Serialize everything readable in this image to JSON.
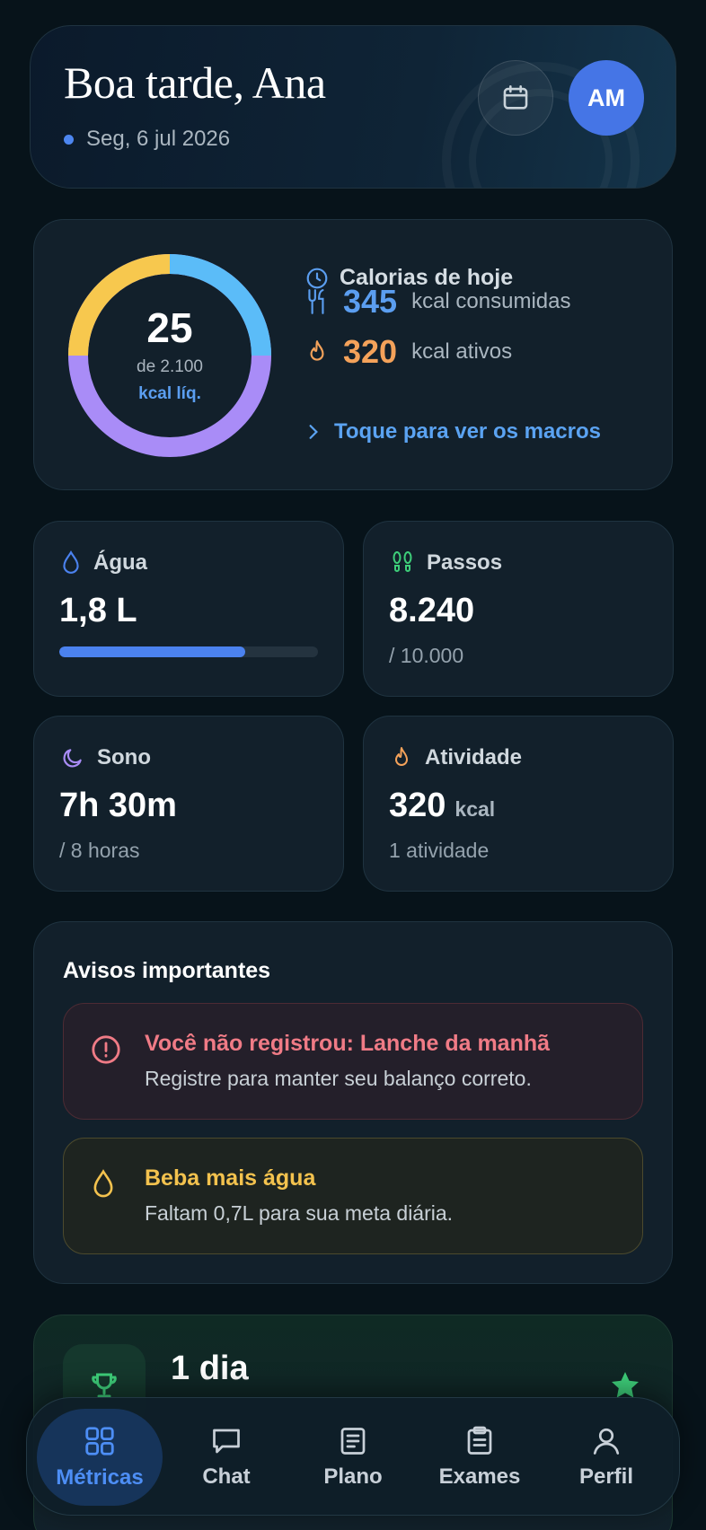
{
  "header": {
    "greeting": "Boa tarde, Ana",
    "date": "Seg, 6 jul 2026",
    "avatar_initials": "AM"
  },
  "calories": {
    "net_value": "25",
    "goal_text": "de 2.100",
    "net_unit": "kcal líq.",
    "title": "Calorias de hoje",
    "consumed_value": "345",
    "consumed_label": "kcal consumidas",
    "active_value": "320",
    "active_label": "kcal ativos",
    "macros_link": "Toque para ver os macros",
    "ring_colors": [
      "#f7c84e",
      "#5bbcf8",
      "#a98cf7"
    ]
  },
  "stats": {
    "water": {
      "label": "Água",
      "value": "1,8 L",
      "progress": 0.72,
      "color": "#4b82ef"
    },
    "steps": {
      "label": "Passos",
      "value": "8.240",
      "sub": "/ 10.000",
      "color": "#3ecf7a"
    },
    "sleep": {
      "label": "Sono",
      "value": "7h 30m",
      "sub": "/ 8 horas",
      "color": "#a98cf7"
    },
    "activity": {
      "label": "Atividade",
      "value": "320",
      "unit": "kcal",
      "sub": "1 atividade",
      "color": "#f4a25a"
    }
  },
  "alerts": {
    "title": "Avisos importantes",
    "items": [
      {
        "title": "Você não registrou: Lanche da manhã",
        "text": "Registre para manter seu balanço correto.",
        "color": "#f07b86"
      },
      {
        "title": "Beba mais água",
        "text": "Faltam 0,7L para sua meta diária.",
        "color": "#f3c24e"
      }
    ]
  },
  "streak": {
    "value": "1 dia"
  },
  "nav": {
    "items": [
      {
        "label": "Métricas",
        "icon": "grid-icon",
        "active": true
      },
      {
        "label": "Chat",
        "icon": "chat-icon",
        "active": false
      },
      {
        "label": "Plano",
        "icon": "document-icon",
        "active": false
      },
      {
        "label": "Exames",
        "icon": "clipboard-icon",
        "active": false
      },
      {
        "label": "Perfil",
        "icon": "user-icon",
        "active": false
      }
    ]
  }
}
